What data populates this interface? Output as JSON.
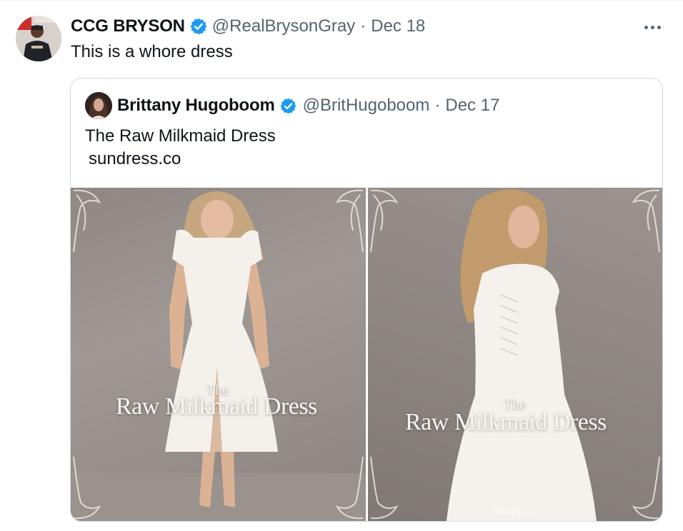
{
  "tweet": {
    "author_name": "CCG BRYSON",
    "handle": "@RealBrysonGray",
    "separator": "·",
    "date": "Dec 18",
    "text": "This is a whore dress"
  },
  "quoted_tweet": {
    "author_name": "Brittany Hugoboom",
    "handle": "@BritHugoboom",
    "separator": "·",
    "date": "Dec 17",
    "text": "The Raw Milkmaid Dress",
    "link_text": "sundress.co",
    "images": [
      {
        "overlay_small": "The",
        "overlay_big": "Raw Milkmaid Dress"
      },
      {
        "overlay_small": "The",
        "overlay_big": "Raw Milkmaid Dress",
        "watermark": "sundress.co"
      }
    ]
  },
  "colors": {
    "text_primary": "#0f1419",
    "text_secondary": "#536471",
    "verified_blue": "#1d9bf0",
    "border": "#cfd9de"
  },
  "icons": {
    "verified": "verified-badge-icon",
    "more": "more-options-icon"
  }
}
